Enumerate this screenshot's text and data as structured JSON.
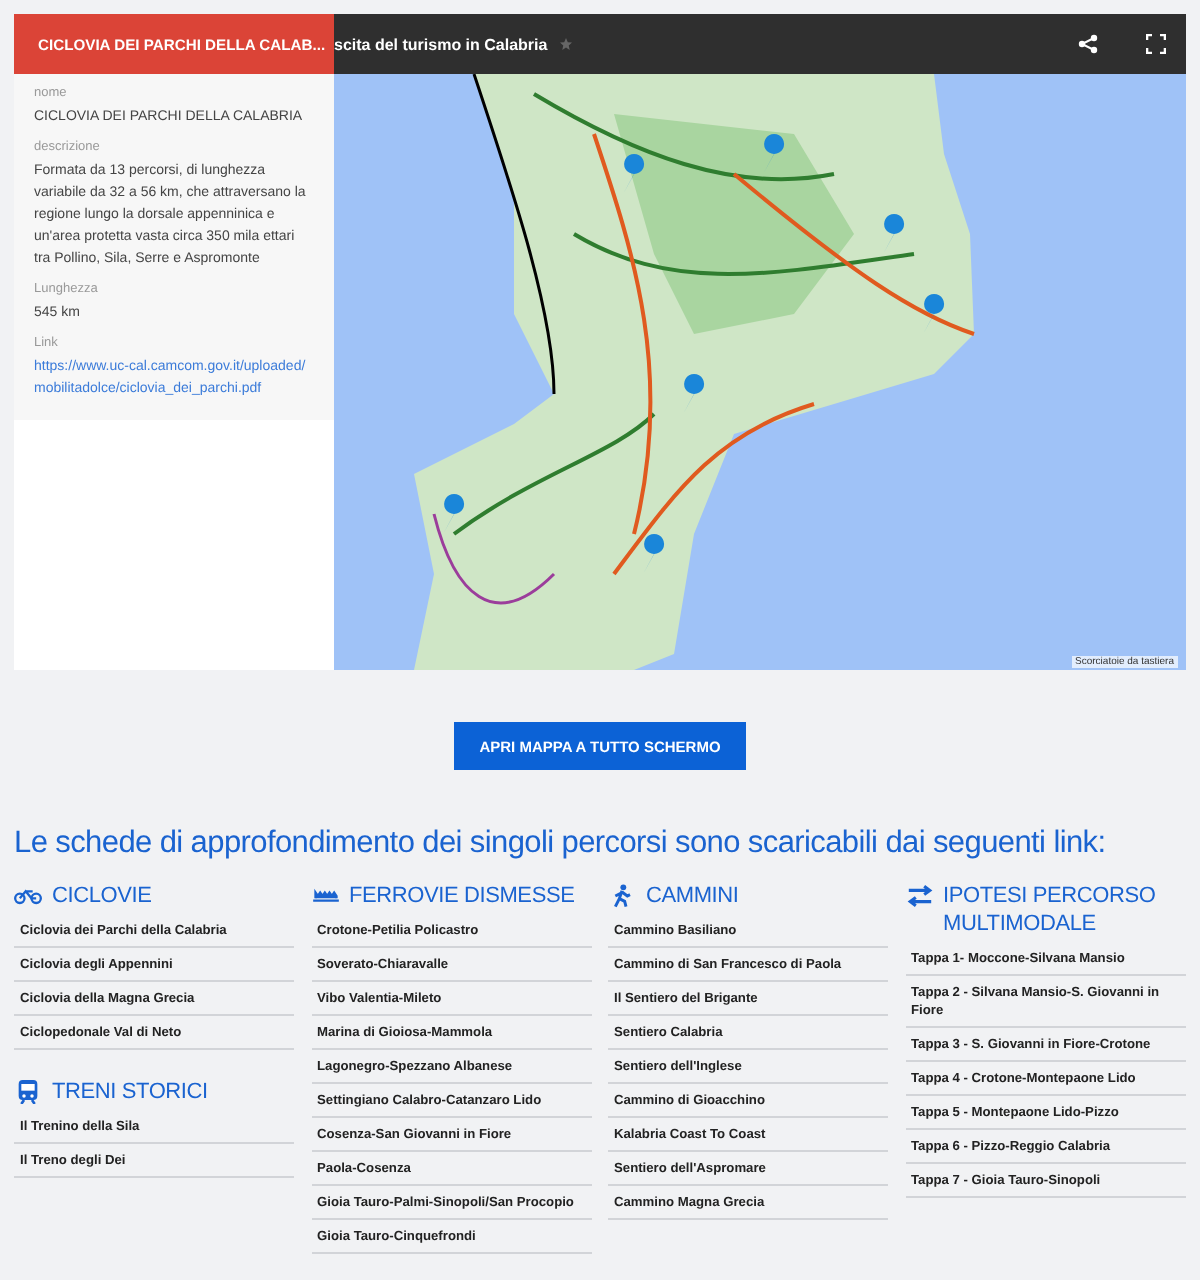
{
  "panel": {
    "title": "CICLOVIA DEI PARCHI DELLA CALAB...",
    "fields": [
      {
        "kind": "text",
        "label": "nome",
        "value": "CICLOVIA DEI PARCHI DELLA CALABRIA"
      },
      {
        "kind": "text",
        "label": "descrizione",
        "value": "Formata da 13 percorsi, di lunghezza variabile da 32 a 56 km, che attraversano la regione lungo la dorsale appenninica e un'area protetta vasta circa 350 mila ettari tra Pollino, Sila, Serre e Aspromonte"
      },
      {
        "kind": "text",
        "label": "Lunghezza",
        "value": "545 km"
      },
      {
        "kind": "link",
        "label": "Link",
        "value": "https://www.uc-cal.camcom.gov.it/uploaded/mobilitadolce/ciclovia_dei_parchi.pdf"
      }
    ]
  },
  "map": {
    "title": "scita del turismo in Calabria",
    "attribution": "Scorciatoie da tastiera"
  },
  "button": "APRI MAPPA A TUTTO SCHERMO",
  "heading": "Le schede di approfondimento dei singoli percorsi sono scaricabili dai seguenti link:",
  "columns": [
    {
      "sections": [
        {
          "kind": "bike",
          "title": "CICLOVIE",
          "items": [
            "Ciclovia dei Parchi della Calabria",
            "Ciclovia degli Appennini",
            "Ciclovia della Magna Grecia",
            "Ciclopedonale Val di Neto"
          ]
        },
        {
          "kind": "train",
          "title": "TRENI STORICI",
          "items": [
            "Il Trenino della Sila",
            "Il Treno degli Dei"
          ]
        }
      ]
    },
    {
      "sections": [
        {
          "kind": "rail",
          "title": "FERROVIE DISMESSE",
          "items": [
            "Crotone-Petilia Policastro",
            "Soverato-Chiaravalle",
            "Vibo Valentia-Mileto",
            "Marina di Gioiosa-Mammola",
            "Lagonegro-Spezzano Albanese",
            "Settingiano Calabro-Catanzaro Lido",
            "Cosenza-San Giovanni in Fiore",
            "Paola-Cosenza",
            "Gioia Tauro-Palmi-Sinopoli/San Procopio",
            "Gioia Tauro-Cinquefrondi"
          ]
        }
      ]
    },
    {
      "sections": [
        {
          "kind": "walk",
          "title": "CAMMINI",
          "items": [
            "Cammino Basiliano",
            "Cammino di San Francesco di Paola",
            "Il Sentiero del Brigante",
            "Sentiero Calabria",
            "Sentiero dell'Inglese",
            "Cammino di Gioacchino",
            "Kalabria Coast To Coast",
            "Sentiero dell'Aspromare",
            "Cammino Magna Grecia"
          ]
        }
      ]
    },
    {
      "sections": [
        {
          "kind": "multimodal",
          "title": "IPOTESI PERCORSO MULTIMODALE",
          "items": [
            "Tappa 1- Moccone-Silvana Mansio",
            "Tappa 2 - Silvana Mansio-S. Giovanni in Fiore",
            "Tappa 3 - S. Giovanni in Fiore-Crotone",
            "Tappa 4 - Crotone-Montepaone Lido",
            "Tappa 5 - Montepaone Lido-Pizzo",
            "Tappa 6 - Pizzo-Reggio Calabria",
            "Tappa 7 - Gioia Tauro-Sinopoli"
          ]
        }
      ]
    }
  ]
}
